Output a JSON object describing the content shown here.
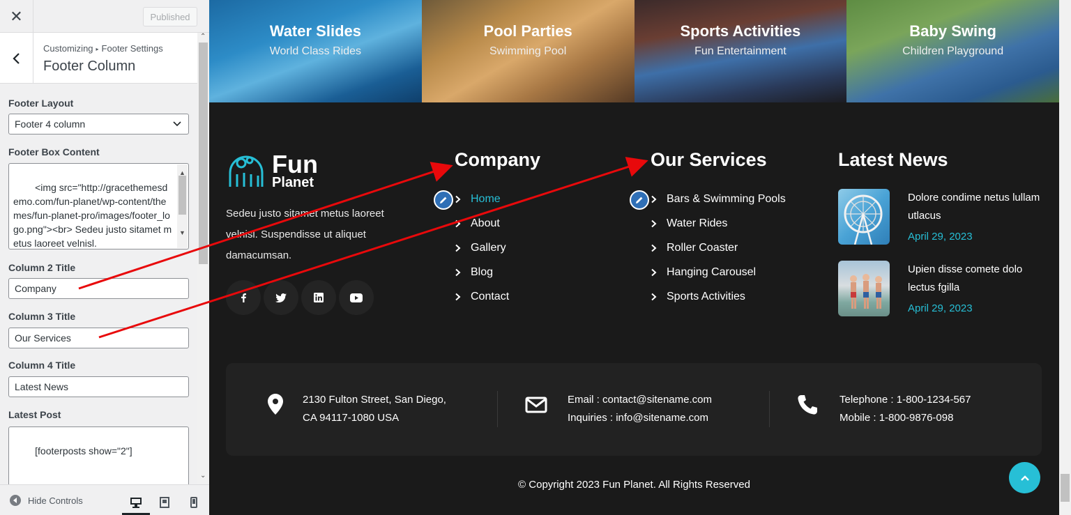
{
  "customizer": {
    "close_glyph": "✕",
    "published_label": "Published",
    "breadcrumb_root": "Customizing",
    "breadcrumb_parent": "Footer Settings",
    "section_title": "Footer Column",
    "footer_layout": {
      "label": "Footer Layout",
      "value": "Footer 4 column"
    },
    "footer_box_content": {
      "label": "Footer Box Content",
      "value": "<img src=\"http://gracethemesdemo.com/fun-planet/wp-content/themes/fun-planet-pro/images/footer_logo.png\"><br> Sedeu justo sitamet metus laoreet velnisl."
    },
    "column2_title": {
      "label": "Column 2 Title",
      "value": "Company"
    },
    "column3_title": {
      "label": "Column 3 Title",
      "value": "Our Services"
    },
    "column4_title": {
      "label": "Column 4 Title",
      "value": "Latest News"
    },
    "latest_post": {
      "label": "Latest Post",
      "value": "[footerposts show=\"2\"]"
    },
    "hide_controls_label": "Hide Controls"
  },
  "preview": {
    "tiles": [
      {
        "title": "Water Slides",
        "subtitle": "World Class Rides"
      },
      {
        "title": "Pool Parties",
        "subtitle": "Swimming Pool"
      },
      {
        "title": "Sports Activities",
        "subtitle": "Fun Entertainment"
      },
      {
        "title": "Baby Swing",
        "subtitle": "Children Playground"
      }
    ],
    "logo": {
      "line1": "Fun",
      "line2": "Planet"
    },
    "about_text": "Sedeu justo sitamet metus laoreet velnisl. Suspendisse ut aliquet damacumsan.",
    "company": {
      "title": "Company",
      "items": [
        "Home",
        "About",
        "Gallery",
        "Blog",
        "Contact"
      ]
    },
    "services": {
      "title": "Our Services",
      "items": [
        "Bars & Swimming Pools",
        "Water Rides",
        "Roller Coaster",
        "Hanging Carousel",
        "Sports Activities"
      ]
    },
    "news": {
      "title": "Latest News",
      "posts": [
        {
          "title": "Dolore condime netus lullam utlacus",
          "date": "April 29, 2023"
        },
        {
          "title": "Upien disse comete dolo lectus fgilla",
          "date": "April 29, 2023"
        }
      ]
    },
    "contact": {
      "address_line1": "2130 Fulton Street, San Diego,",
      "address_line2": "CA 94117-1080 USA",
      "email_line1": "Email : contact@sitename.com",
      "email_line2": "Inquiries : info@sitename.com",
      "phone_line1": "Telephone : 1-800-1234-567",
      "phone_line2": "Mobile : 1-800-9876-098"
    },
    "copyright": "© Copyright 2023 Fun Planet. All Rights Reserved"
  },
  "colors": {
    "accent": "#27bfd6",
    "edit_pen": "#2f6fb6",
    "annotation_arrow": "#e8090b",
    "footer_bg": "#1a1a1a"
  }
}
